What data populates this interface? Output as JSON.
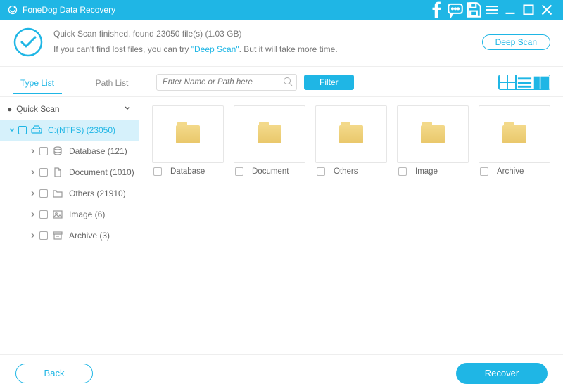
{
  "app": {
    "title": "FoneDog Data Recovery"
  },
  "status": {
    "line1": "Quick Scan finished, found 23050 file(s) (1.03 GB)",
    "line2_pre": "If you can't find lost files, you can try ",
    "line2_link": "\"Deep Scan\"",
    "line2_post": ". But it will take more time.",
    "deep_scan_btn": "Deep Scan"
  },
  "tabs": {
    "type": "Type List",
    "path": "Path List"
  },
  "search": {
    "placeholder": "Enter Name or Path here"
  },
  "filter_btn": "Filter",
  "tree": {
    "root": "Quick Scan",
    "drive": "C:(NTFS) (23050)",
    "children": [
      {
        "label": "Database (121)",
        "icon": "db"
      },
      {
        "label": "Document (1010)",
        "icon": "doc"
      },
      {
        "label": "Others (21910)",
        "icon": "folder"
      },
      {
        "label": "Image (6)",
        "icon": "image"
      },
      {
        "label": "Archive (3)",
        "icon": "archive"
      }
    ]
  },
  "grid": {
    "items": [
      {
        "label": "Database"
      },
      {
        "label": "Document"
      },
      {
        "label": "Others"
      },
      {
        "label": "Image"
      },
      {
        "label": "Archive"
      }
    ]
  },
  "footer": {
    "back": "Back",
    "recover": "Recover"
  }
}
